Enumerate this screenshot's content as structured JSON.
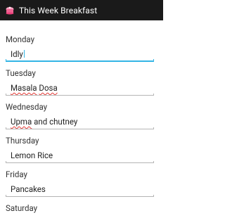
{
  "action_bar": {
    "title": "This Week Breakfast",
    "icon": "pink-cake-icon"
  },
  "days": [
    {
      "label": "Monday",
      "value": "Idly"
    },
    {
      "label": "Tuesday",
      "value_parts": [
        "Masala",
        " ",
        "Dosa"
      ]
    },
    {
      "label": "Wednesday",
      "value_parts": [
        "Upma",
        " and chutney"
      ]
    },
    {
      "label": "Thursday",
      "value": "Lemon Rice"
    },
    {
      "label": "Friday",
      "value": "Pancakes"
    },
    {
      "label": "Saturday"
    }
  ],
  "colors": {
    "action_bar_bg": "#1a1a1a",
    "focus_accent": "#33b5e5",
    "spellcheck": "#e53935"
  }
}
